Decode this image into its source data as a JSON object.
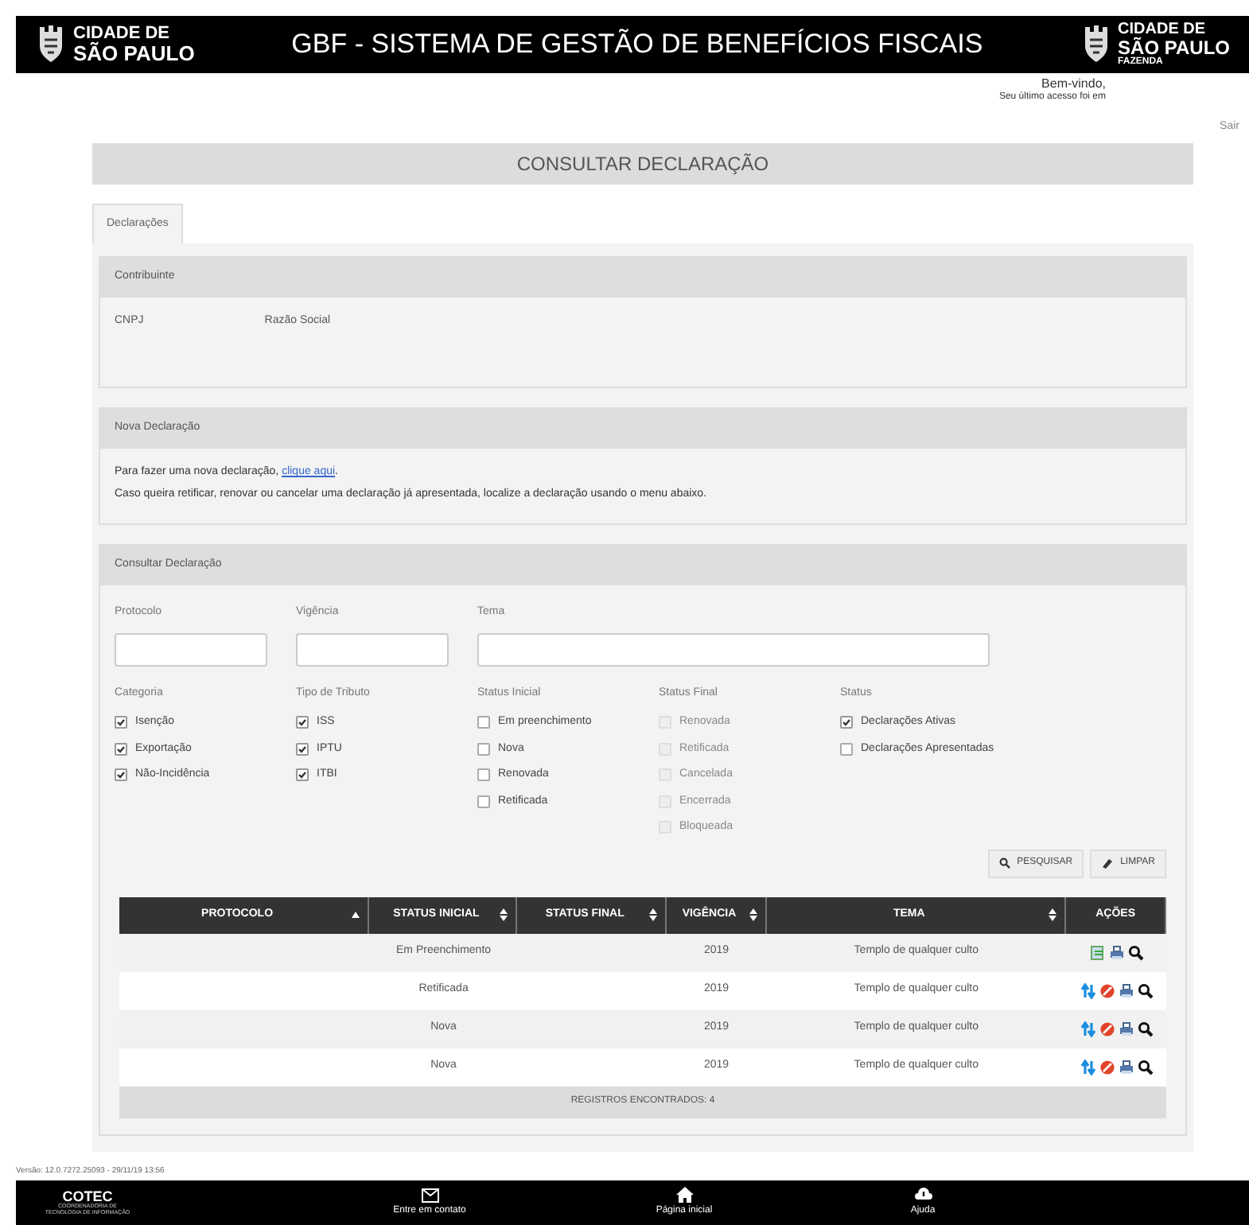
{
  "header": {
    "logo_left": {
      "line1": "CIDADE DE",
      "line2": "SÃO PAULO"
    },
    "title": "GBF - SISTEMA DE GESTÃO DE BENEFÍCIOS FISCAIS",
    "logo_right": {
      "line1": "CIDADE DE",
      "line2": "SÃO PAULO",
      "line3": "FAZENDA"
    }
  },
  "user": {
    "welcome": "Bem-vindo,",
    "last_access": "Seu último acesso foi em",
    "logout": "Sair"
  },
  "page_title": "CONSULTAR DECLARAÇÃO",
  "tabs": [
    {
      "label": "Declarações",
      "selected": true
    }
  ],
  "contribuinte": {
    "title": "Contribuinte",
    "fields": [
      "CNPJ",
      "Razão Social"
    ]
  },
  "nova_declaracao": {
    "title": "Nova Declaração",
    "line1": "Para fazer uma nova declaração, ",
    "link": "clique aqui",
    "line1_end": ".",
    "line2": "Caso queira retificar, renovar ou cancelar uma declaração já apresentada, localize a declaração usando o menu abaixo."
  },
  "consultar": {
    "title": "Consultar Declaração",
    "inputs": [
      {
        "label": "Protocolo",
        "kind": "short"
      },
      {
        "label": "Vigência",
        "kind": "short"
      },
      {
        "label": "Tema",
        "kind": "long"
      }
    ],
    "groups": [
      {
        "label": "Categoria",
        "options": [
          {
            "label": "Isenção",
            "checked": true,
            "disabled": false
          },
          {
            "label": "Exportação",
            "checked": true,
            "disabled": false
          },
          {
            "label": "Não-Incidência",
            "checked": true,
            "disabled": false
          }
        ]
      },
      {
        "label": "Tipo de Tributo",
        "options": [
          {
            "label": "ISS",
            "checked": true,
            "disabled": false
          },
          {
            "label": "IPTU",
            "checked": true,
            "disabled": false
          },
          {
            "label": "ITBI",
            "checked": true,
            "disabled": false
          }
        ]
      },
      {
        "label": "Status Inicial",
        "options": [
          {
            "label": "Em preenchimento",
            "checked": false,
            "disabled": false
          },
          {
            "label": "Nova",
            "checked": false,
            "disabled": false
          },
          {
            "label": "Renovada",
            "checked": false,
            "disabled": false
          },
          {
            "label": "Retificada",
            "checked": false,
            "disabled": false
          }
        ]
      },
      {
        "label": "Status Final",
        "options": [
          {
            "label": "Renovada",
            "checked": false,
            "disabled": true
          },
          {
            "label": "Retificada",
            "checked": false,
            "disabled": true
          },
          {
            "label": "Cancelada",
            "checked": false,
            "disabled": true
          },
          {
            "label": "Encerrada",
            "checked": false,
            "disabled": true
          },
          {
            "label": "Bloqueada",
            "checked": false,
            "disabled": true
          }
        ]
      },
      {
        "label": "Status",
        "options": [
          {
            "label": "Declarações Ativas",
            "checked": true,
            "disabled": false
          },
          {
            "label": "Declarações Apresentadas",
            "checked": false,
            "disabled": false
          }
        ]
      }
    ],
    "buttons": [
      {
        "kind": "search",
        "label": "PESQUISAR"
      },
      {
        "kind": "clear",
        "label": "LIMPAR"
      }
    ]
  },
  "table": {
    "columns": [
      {
        "label": "PROTOCOLO",
        "sortable": true,
        "sorted": true
      },
      {
        "label": "STATUS INICIAL",
        "sortable": true,
        "sorted": false
      },
      {
        "label": "STATUS FINAL",
        "sortable": true,
        "sorted": false
      },
      {
        "label": "VIGÊNCIA",
        "sortable": true,
        "sorted": false
      },
      {
        "label": "TEMA",
        "sortable": true,
        "sorted": false
      },
      {
        "label": "AÇÕES",
        "sortable": false,
        "sorted": false
      }
    ],
    "rows": [
      {
        "status_inicial": "Em Preenchimento",
        "vigencia": "2019",
        "tema": "Templo de qualquer culto",
        "actions": [
          {
            "kind": "edit"
          },
          {
            "kind": "print"
          },
          {
            "kind": "search"
          }
        ]
      },
      {
        "status_inicial": "Retificada",
        "vigencia": "2019",
        "tema": "Templo de qualquer culto",
        "actions": [
          {
            "kind": "renew"
          },
          {
            "kind": "cancel"
          },
          {
            "kind": "print"
          },
          {
            "kind": "search"
          }
        ]
      },
      {
        "status_inicial": "Nova",
        "vigencia": "2019",
        "tema": "Templo de qualquer culto",
        "actions": [
          {
            "kind": "renew"
          },
          {
            "kind": "cancel"
          },
          {
            "kind": "print"
          },
          {
            "kind": "search"
          }
        ]
      },
      {
        "status_inicial": "Nova",
        "vigencia": "2019",
        "tema": "Templo de qualquer culto",
        "actions": [
          {
            "kind": "renew"
          },
          {
            "kind": "cancel"
          },
          {
            "kind": "print"
          },
          {
            "kind": "search"
          }
        ]
      }
    ],
    "footer": "REGISTROS ENCONTRADOS: 4"
  },
  "version": "Versão: 12.0.7272.25093 - 29/11/19 13:56",
  "footer": {
    "logo": {
      "name": "COTEC",
      "line1": "COORDENADORIA DE",
      "line2": "TECNOLOGIA DE INFORMAÇÃO"
    },
    "links": [
      {
        "kind": "mail",
        "label": "Entre em contato"
      },
      {
        "kind": "home",
        "label": "Página inicial"
      },
      {
        "kind": "help",
        "label": "Ajuda"
      }
    ]
  }
}
